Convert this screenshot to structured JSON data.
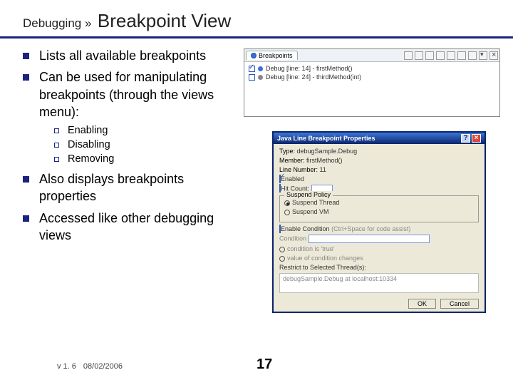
{
  "header": {
    "prefix": "Debugging »",
    "title": "Breakpoint View"
  },
  "bullets": {
    "b1": "Lists all available breakpoints",
    "b2": "Can be used for manipulating breakpoints (through the views menu):",
    "b3": "Also displays breakpoints properties",
    "b4": "Accessed like other debugging views"
  },
  "subs": {
    "s1": "Enabling",
    "s2": "Disabling",
    "s3": "Removing"
  },
  "bp_view": {
    "tab": "Breakpoints",
    "line1": "Debug [line: 14] - firstMethod()",
    "line2": "Debug [line: 24] - thirdMethod(int)"
  },
  "dialog": {
    "title": "Java Line Breakpoint Properties",
    "type_lbl": "Type:",
    "type_val": "debugSample.Debug",
    "member_lbl": "Member:",
    "member_val": "firstMethod()",
    "line_lbl": "Line Number:",
    "line_val": "11",
    "enabled": "Enabled",
    "hit_lbl": "Hit Count:",
    "suspend_group": "Suspend Policy",
    "suspend_thread": "Suspend Thread",
    "suspend_vm": "Suspend VM",
    "enable_cond": "Enable Condition",
    "enable_cond_hint": "(Ctrl+Space for code assist)",
    "cond_lbl": "Condition",
    "radio_cond_true": "condition is 'true'",
    "radio_cond_change": "value of condition changes",
    "restrict_lbl": "Restrict to Selected Thread(s):",
    "restrict_item": "debugSample.Debug at localhost:10334",
    "ok": "OK",
    "cancel": "Cancel"
  },
  "footer": {
    "ver": "v 1. 6",
    "date": "08/02/2006",
    "page": "17"
  }
}
